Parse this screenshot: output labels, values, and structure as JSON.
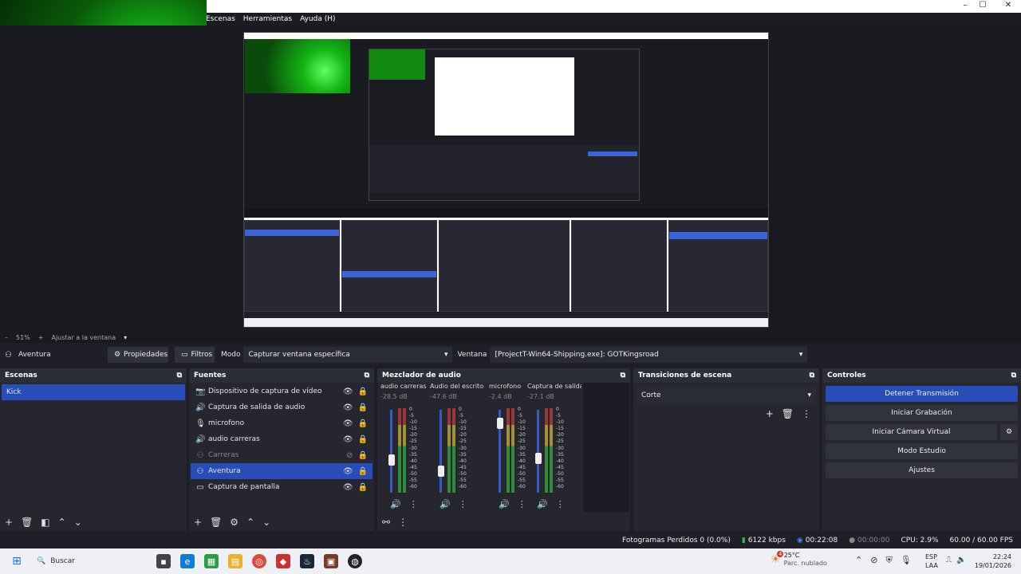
{
  "menu": [
    "Escenas",
    "Herramientas",
    "Ayuda (H)"
  ],
  "window_buttons": [
    "–",
    "☐",
    "✕"
  ],
  "zoom": {
    "minus": "–",
    "value": "51%",
    "plus": "+",
    "fit_label": "Ajustar a la ventana"
  },
  "source_toolbar": {
    "scene_name": "Aventura",
    "properties": "Propiedades",
    "filters": "Filtros",
    "mode_label": "Modo",
    "mode_value": "Capturar ventana específica",
    "window_label": "Ventana",
    "window_value": "[ProjectT-Win64-Shipping.exe]: GOTKingsroad"
  },
  "scenes": {
    "title": "Escenas",
    "items": [
      "Kick"
    ]
  },
  "sources": {
    "title": "Fuentes",
    "items": [
      {
        "name": "Dispositivo de captura de vídeo",
        "icon": "camera-icon"
      },
      {
        "name": "Captura de salida de audio",
        "icon": "speaker-icon"
      },
      {
        "name": "microfono",
        "icon": "microphone-icon"
      },
      {
        "name": "audio carreras",
        "icon": "speaker-icon"
      },
      {
        "name": "Carreras",
        "icon": "game-capture-icon"
      },
      {
        "name": "Aventura",
        "icon": "game-capture-icon"
      },
      {
        "name": "Captura de pantalla",
        "icon": "monitor-icon"
      }
    ]
  },
  "mixer": {
    "title": "Mezclador de audio",
    "channels": [
      {
        "name": "audio carreras",
        "db": "-28.5 dB"
      },
      {
        "name": "Audio del escritorio",
        "db": "-47.6 dB"
      },
      {
        "name": "microfono",
        "db": "-2.4 dB"
      },
      {
        "name": "Captura de salida de audio",
        "db": "-27.1 dB"
      }
    ],
    "scale": [
      "0",
      "-5",
      "-10",
      "-15",
      "-20",
      "-25",
      "-30",
      "-35",
      "-40",
      "-45",
      "-50",
      "-55",
      "-60"
    ]
  },
  "transitions": {
    "title": "Transiciones de escena",
    "value": "Corte"
  },
  "controls": {
    "title": "Controles",
    "buttons": [
      "Detener Transmisión",
      "Iniciar Grabación",
      "Iniciar Cámara Virtual",
      "Modo Estudio",
      "Ajustes"
    ]
  },
  "status": {
    "dropped": "Fotogramas Perdidos 0 (0.0%)",
    "kbps": "6122 kbps",
    "stream_time": "00:22:08",
    "rec_time": "00:00:00",
    "cpu": "CPU: 2.9%",
    "fps": "60.00 / 60.00 FPS"
  },
  "taskbar": {
    "search": "Buscar",
    "weather_temp": "25°C",
    "weather_desc": "Parc. nublado",
    "weather_badge": "4",
    "lang_top": "ESP",
    "lang_bottom": "LAA",
    "time": "22:24",
    "date": "19/01/2026"
  },
  "colors": {
    "accent": "#284cb8",
    "panel": "#25262e",
    "background": "#1e1f26"
  }
}
